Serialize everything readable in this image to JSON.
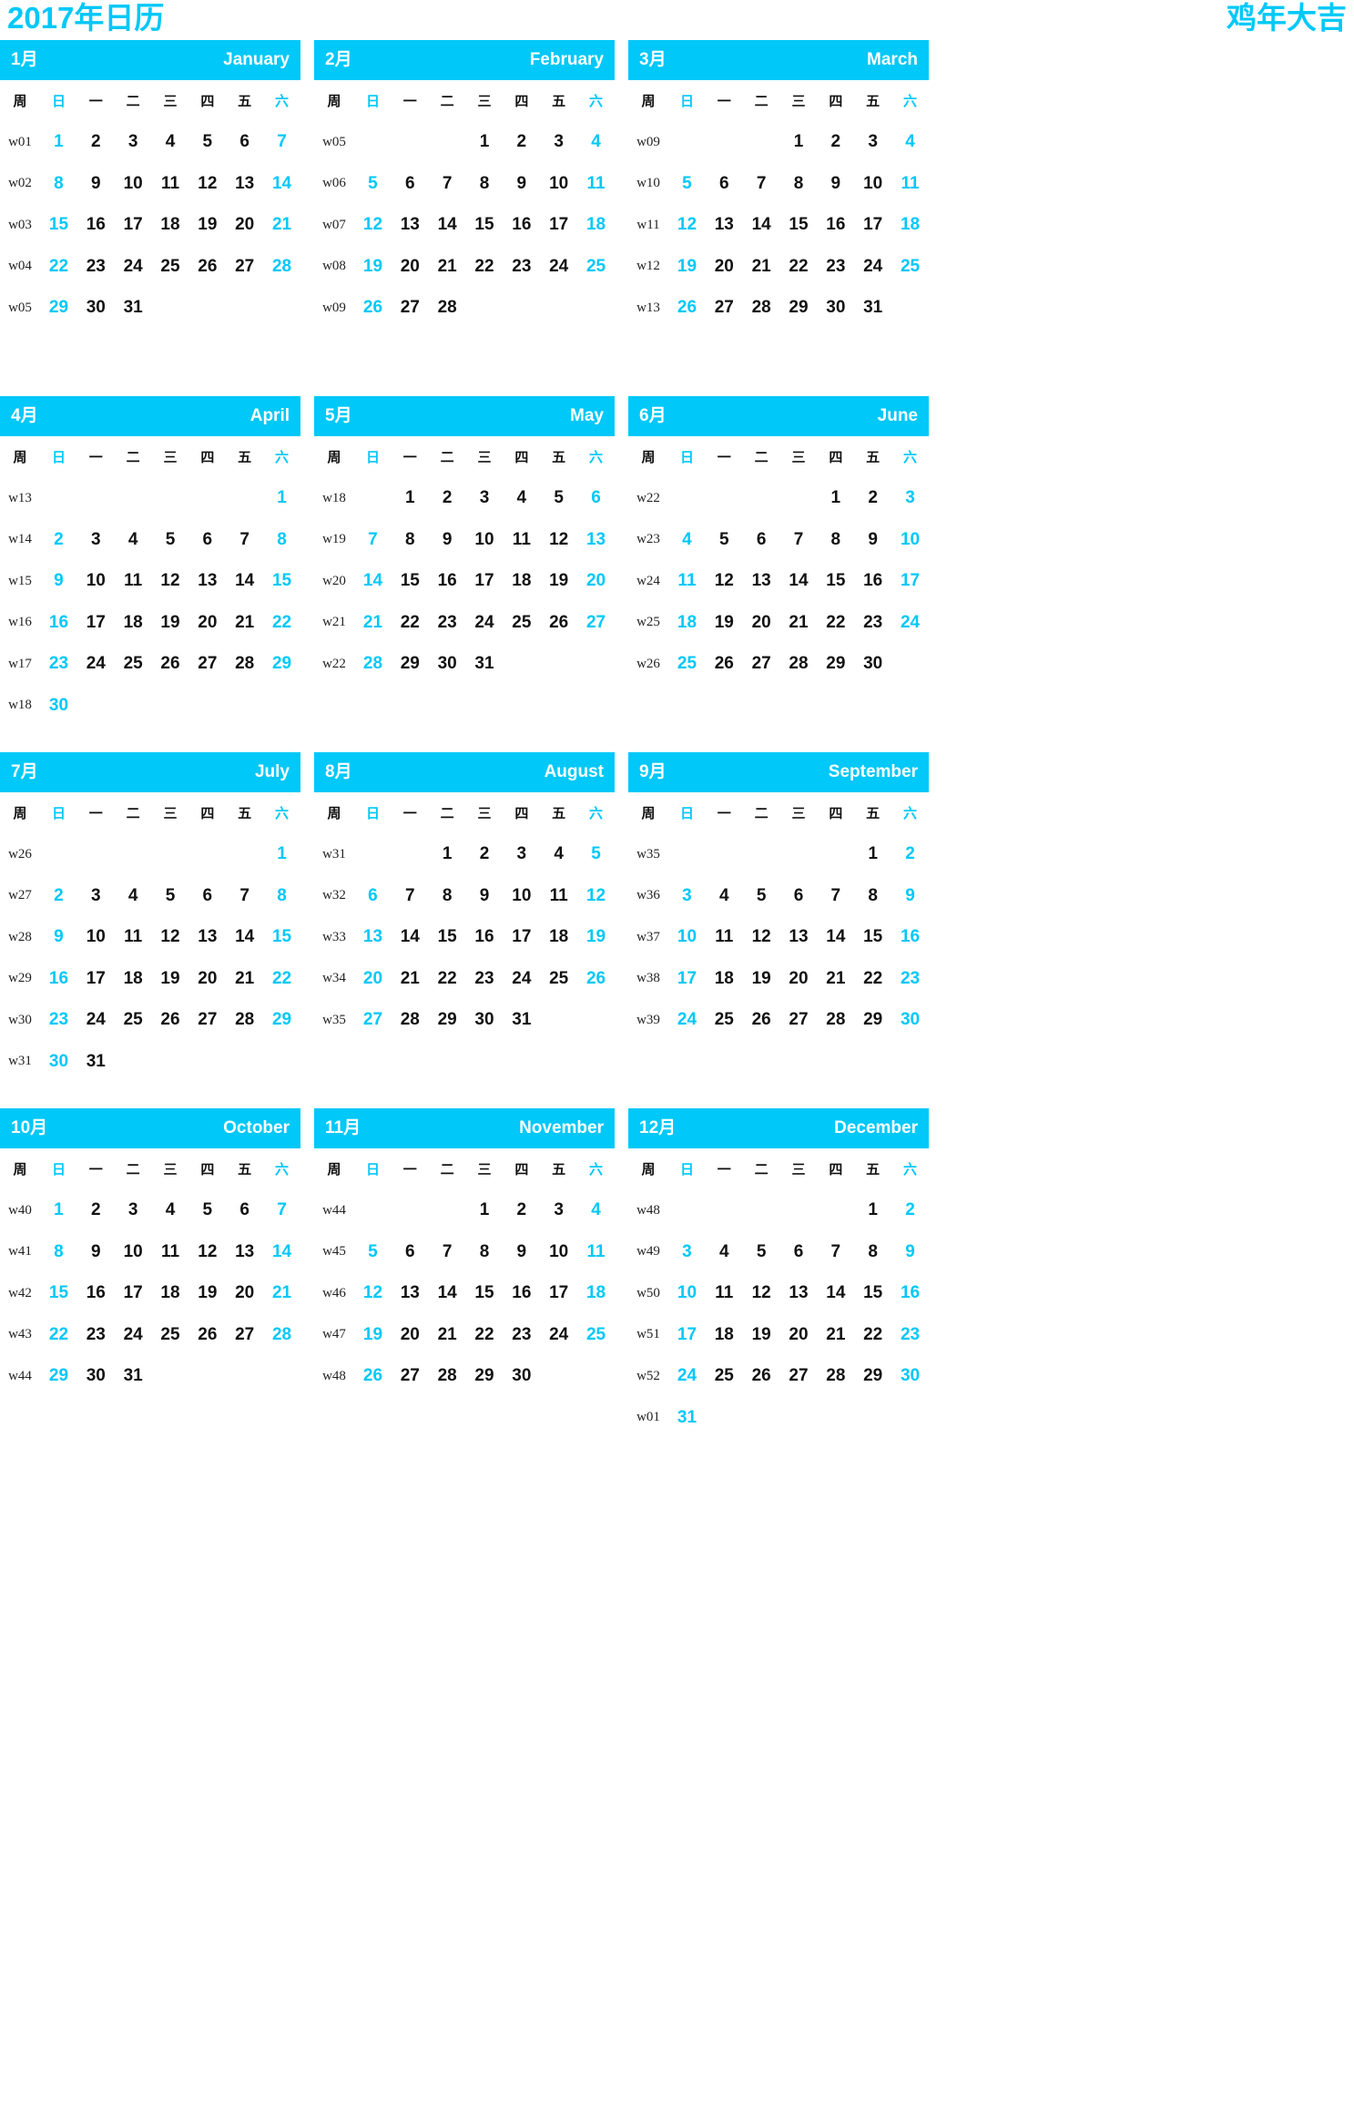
{
  "title": {
    "left": "2017年日历",
    "right": "鸡年大吉"
  },
  "colors": {
    "accent": "#00C8F8",
    "text": "#111111",
    "background": "#FFFFFF"
  },
  "dow_labels": {
    "week_col": "周",
    "days": [
      "日",
      "一",
      "二",
      "三",
      "四",
      "五",
      "六"
    ],
    "weekend_indices": [
      0,
      6
    ]
  },
  "months": [
    {
      "cn": "1月",
      "en": "January",
      "weeks": [
        {
          "w": "w01",
          "days": [
            "1",
            "2",
            "3",
            "4",
            "5",
            "6",
            "7"
          ]
        },
        {
          "w": "w02",
          "days": [
            "8",
            "9",
            "10",
            "11",
            "12",
            "13",
            "14"
          ]
        },
        {
          "w": "w03",
          "days": [
            "15",
            "16",
            "17",
            "18",
            "19",
            "20",
            "21"
          ]
        },
        {
          "w": "w04",
          "days": [
            "22",
            "23",
            "24",
            "25",
            "26",
            "27",
            "28"
          ]
        },
        {
          "w": "w05",
          "days": [
            "29",
            "30",
            "31",
            "",
            "",
            "",
            ""
          ]
        },
        {
          "w": "",
          "days": [
            "",
            "",
            "",
            "",
            "",
            "",
            ""
          ]
        }
      ]
    },
    {
      "cn": "2月",
      "en": "February",
      "weeks": [
        {
          "w": "w05",
          "days": [
            "",
            "",
            "",
            "1",
            "2",
            "3",
            "4"
          ]
        },
        {
          "w": "w06",
          "days": [
            "5",
            "6",
            "7",
            "8",
            "9",
            "10",
            "11"
          ]
        },
        {
          "w": "w07",
          "days": [
            "12",
            "13",
            "14",
            "15",
            "16",
            "17",
            "18"
          ]
        },
        {
          "w": "w08",
          "days": [
            "19",
            "20",
            "21",
            "22",
            "23",
            "24",
            "25"
          ]
        },
        {
          "w": "w09",
          "days": [
            "26",
            "27",
            "28",
            "",
            "",
            "",
            ""
          ]
        },
        {
          "w": "",
          "days": [
            "",
            "",
            "",
            "",
            "",
            "",
            ""
          ]
        }
      ]
    },
    {
      "cn": "3月",
      "en": "March",
      "weeks": [
        {
          "w": "w09",
          "days": [
            "",
            "",
            "",
            "1",
            "2",
            "3",
            "4"
          ]
        },
        {
          "w": "w10",
          "days": [
            "5",
            "6",
            "7",
            "8",
            "9",
            "10",
            "11"
          ]
        },
        {
          "w": "w11",
          "days": [
            "12",
            "13",
            "14",
            "15",
            "16",
            "17",
            "18"
          ]
        },
        {
          "w": "w12",
          "days": [
            "19",
            "20",
            "21",
            "22",
            "23",
            "24",
            "25"
          ]
        },
        {
          "w": "w13",
          "days": [
            "26",
            "27",
            "28",
            "29",
            "30",
            "31",
            ""
          ]
        },
        {
          "w": "",
          "days": [
            "",
            "",
            "",
            "",
            "",
            "",
            ""
          ]
        }
      ]
    },
    {
      "cn": "4月",
      "en": "April",
      "weeks": [
        {
          "w": "w13",
          "days": [
            "",
            "",
            "",
            "",
            "",
            "",
            "1"
          ]
        },
        {
          "w": "w14",
          "days": [
            "2",
            "3",
            "4",
            "5",
            "6",
            "7",
            "8"
          ]
        },
        {
          "w": "w15",
          "days": [
            "9",
            "10",
            "11",
            "12",
            "13",
            "14",
            "15"
          ]
        },
        {
          "w": "w16",
          "days": [
            "16",
            "17",
            "18",
            "19",
            "20",
            "21",
            "22"
          ]
        },
        {
          "w": "w17",
          "days": [
            "23",
            "24",
            "25",
            "26",
            "27",
            "28",
            "29"
          ]
        },
        {
          "w": "w18",
          "days": [
            "30",
            "",
            "",
            "",
            "",
            "",
            ""
          ]
        }
      ]
    },
    {
      "cn": "5月",
      "en": "May",
      "weeks": [
        {
          "w": "w18",
          "days": [
            "",
            "1",
            "2",
            "3",
            "4",
            "5",
            "6"
          ]
        },
        {
          "w": "w19",
          "days": [
            "7",
            "8",
            "9",
            "10",
            "11",
            "12",
            "13"
          ]
        },
        {
          "w": "w20",
          "days": [
            "14",
            "15",
            "16",
            "17",
            "18",
            "19",
            "20"
          ]
        },
        {
          "w": "w21",
          "days": [
            "21",
            "22",
            "23",
            "24",
            "25",
            "26",
            "27"
          ]
        },
        {
          "w": "w22",
          "days": [
            "28",
            "29",
            "30",
            "31",
            "",
            "",
            ""
          ]
        },
        {
          "w": "",
          "days": [
            "",
            "",
            "",
            "",
            "",
            "",
            ""
          ]
        }
      ]
    },
    {
      "cn": "6月",
      "en": "June",
      "weeks": [
        {
          "w": "w22",
          "days": [
            "",
            "",
            "",
            "",
            "1",
            "2",
            "3"
          ]
        },
        {
          "w": "w23",
          "days": [
            "4",
            "5",
            "6",
            "7",
            "8",
            "9",
            "10"
          ]
        },
        {
          "w": "w24",
          "days": [
            "11",
            "12",
            "13",
            "14",
            "15",
            "16",
            "17"
          ]
        },
        {
          "w": "w25",
          "days": [
            "18",
            "19",
            "20",
            "21",
            "22",
            "23",
            "24"
          ]
        },
        {
          "w": "w26",
          "days": [
            "25",
            "26",
            "27",
            "28",
            "29",
            "30",
            ""
          ]
        },
        {
          "w": "",
          "days": [
            "",
            "",
            "",
            "",
            "",
            "",
            ""
          ]
        }
      ]
    },
    {
      "cn": "7月",
      "en": "July",
      "weeks": [
        {
          "w": "w26",
          "days": [
            "",
            "",
            "",
            "",
            "",
            "",
            "1"
          ]
        },
        {
          "w": "w27",
          "days": [
            "2",
            "3",
            "4",
            "5",
            "6",
            "7",
            "8"
          ]
        },
        {
          "w": "w28",
          "days": [
            "9",
            "10",
            "11",
            "12",
            "13",
            "14",
            "15"
          ]
        },
        {
          "w": "w29",
          "days": [
            "16",
            "17",
            "18",
            "19",
            "20",
            "21",
            "22"
          ]
        },
        {
          "w": "w30",
          "days": [
            "23",
            "24",
            "25",
            "26",
            "27",
            "28",
            "29"
          ]
        },
        {
          "w": "w31",
          "days": [
            "30",
            "31",
            "",
            "",
            "",
            "",
            ""
          ]
        }
      ]
    },
    {
      "cn": "8月",
      "en": "August",
      "weeks": [
        {
          "w": "w31",
          "days": [
            "",
            "",
            "1",
            "2",
            "3",
            "4",
            "5"
          ]
        },
        {
          "w": "w32",
          "days": [
            "6",
            "7",
            "8",
            "9",
            "10",
            "11",
            "12"
          ]
        },
        {
          "w": "w33",
          "days": [
            "13",
            "14",
            "15",
            "16",
            "17",
            "18",
            "19"
          ]
        },
        {
          "w": "w34",
          "days": [
            "20",
            "21",
            "22",
            "23",
            "24",
            "25",
            "26"
          ]
        },
        {
          "w": "w35",
          "days": [
            "27",
            "28",
            "29",
            "30",
            "31",
            "",
            ""
          ]
        },
        {
          "w": "",
          "days": [
            "",
            "",
            "",
            "",
            "",
            "",
            ""
          ]
        }
      ]
    },
    {
      "cn": "9月",
      "en": "September",
      "weeks": [
        {
          "w": "w35",
          "days": [
            "",
            "",
            "",
            "",
            "",
            "1",
            "2"
          ]
        },
        {
          "w": "w36",
          "days": [
            "3",
            "4",
            "5",
            "6",
            "7",
            "8",
            "9"
          ]
        },
        {
          "w": "w37",
          "days": [
            "10",
            "11",
            "12",
            "13",
            "14",
            "15",
            "16"
          ]
        },
        {
          "w": "w38",
          "days": [
            "17",
            "18",
            "19",
            "20",
            "21",
            "22",
            "23"
          ]
        },
        {
          "w": "w39",
          "days": [
            "24",
            "25",
            "26",
            "27",
            "28",
            "29",
            "30"
          ]
        },
        {
          "w": "",
          "days": [
            "",
            "",
            "",
            "",
            "",
            "",
            ""
          ]
        }
      ]
    },
    {
      "cn": "10月",
      "en": "October",
      "weeks": [
        {
          "w": "w40",
          "days": [
            "1",
            "2",
            "3",
            "4",
            "5",
            "6",
            "7"
          ]
        },
        {
          "w": "w41",
          "days": [
            "8",
            "9",
            "10",
            "11",
            "12",
            "13",
            "14"
          ]
        },
        {
          "w": "w42",
          "days": [
            "15",
            "16",
            "17",
            "18",
            "19",
            "20",
            "21"
          ]
        },
        {
          "w": "w43",
          "days": [
            "22",
            "23",
            "24",
            "25",
            "26",
            "27",
            "28"
          ]
        },
        {
          "w": "w44",
          "days": [
            "29",
            "30",
            "31",
            "",
            "",
            "",
            ""
          ]
        },
        {
          "w": "",
          "days": [
            "",
            "",
            "",
            "",
            "",
            "",
            ""
          ]
        }
      ]
    },
    {
      "cn": "11月",
      "en": "November",
      "weeks": [
        {
          "w": "w44",
          "days": [
            "",
            "",
            "",
            "1",
            "2",
            "3",
            "4"
          ]
        },
        {
          "w": "w45",
          "days": [
            "5",
            "6",
            "7",
            "8",
            "9",
            "10",
            "11"
          ]
        },
        {
          "w": "w46",
          "days": [
            "12",
            "13",
            "14",
            "15",
            "16",
            "17",
            "18"
          ]
        },
        {
          "w": "w47",
          "days": [
            "19",
            "20",
            "21",
            "22",
            "23",
            "24",
            "25"
          ]
        },
        {
          "w": "w48",
          "days": [
            "26",
            "27",
            "28",
            "29",
            "30",
            "",
            ""
          ]
        },
        {
          "w": "",
          "days": [
            "",
            "",
            "",
            "",
            "",
            "",
            ""
          ]
        }
      ]
    },
    {
      "cn": "12月",
      "en": "December",
      "weeks": [
        {
          "w": "w48",
          "days": [
            "",
            "",
            "",
            "",
            "",
            "1",
            "2"
          ]
        },
        {
          "w": "w49",
          "days": [
            "3",
            "4",
            "5",
            "6",
            "7",
            "8",
            "9"
          ]
        },
        {
          "w": "w50",
          "days": [
            "10",
            "11",
            "12",
            "13",
            "14",
            "15",
            "16"
          ]
        },
        {
          "w": "w51",
          "days": [
            "17",
            "18",
            "19",
            "20",
            "21",
            "22",
            "23"
          ]
        },
        {
          "w": "w52",
          "days": [
            "24",
            "25",
            "26",
            "27",
            "28",
            "29",
            "30"
          ]
        },
        {
          "w": "w01",
          "days": [
            "31",
            "",
            "",
            "",
            "",
            "",
            ""
          ]
        }
      ]
    }
  ]
}
